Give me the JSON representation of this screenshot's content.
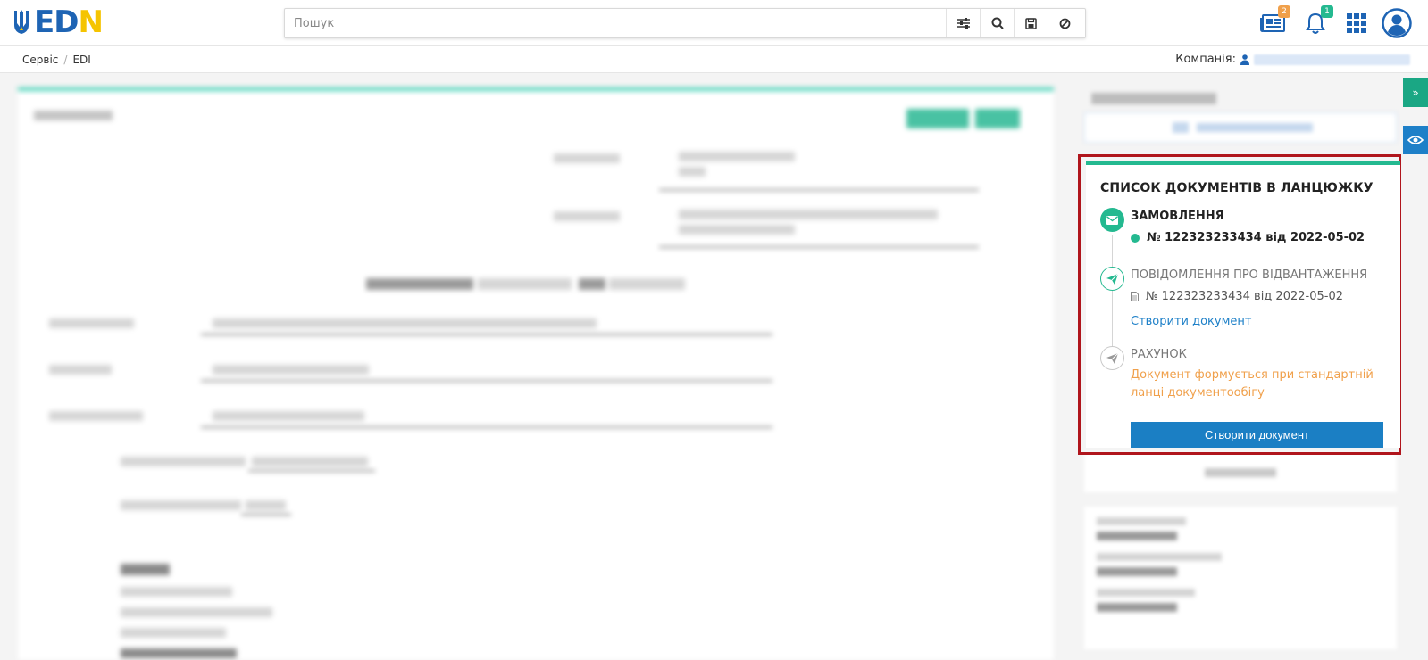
{
  "header": {
    "logo_text": "EDIN",
    "search_placeholder": "Пошук",
    "news_badge": "2",
    "notifications_badge": "1"
  },
  "breadcrumbs": [
    "Сервіс",
    "EDI"
  ],
  "company_label": "Компанія:",
  "chain_panel": {
    "title": "СПИСОК ДОКУМЕНТІВ В ЛАНЦЮЖКУ",
    "steps": [
      {
        "title": "ЗАМОВЛЕННЯ",
        "document": "№ 122323233434 від 2022-05-02"
      },
      {
        "title": "ПОВІДОМЛЕННЯ ПРО ВІДВАНТАЖЕННЯ",
        "document": "№ 122323233434 від 2022-05-02",
        "create_link": "Створити документ"
      },
      {
        "title": "РАХУНОК",
        "warning": "Документ формується при стандартній ланці документообігу",
        "create_button": "Створити документ"
      }
    ]
  },
  "colors": {
    "accent_green": "#24b990",
    "primary_blue": "#1b7fc4",
    "warning_orange": "#f0a04b",
    "highlight_red": "#b0151c",
    "logo_blue": "#1e64b4",
    "logo_yellow": "#f5c400"
  }
}
